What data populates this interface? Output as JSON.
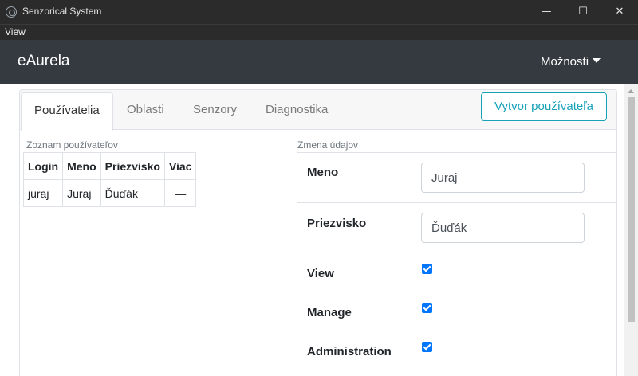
{
  "window": {
    "title": "Senzorical System",
    "controls": {
      "minimize": "—",
      "maximize": "☐",
      "close": "✕"
    }
  },
  "menu": {
    "view_label": "View"
  },
  "navbar": {
    "brand": "eAurela",
    "options_label": "Možnosti"
  },
  "tabs": [
    {
      "label": "Používatelia",
      "active": true
    },
    {
      "label": "Oblasti",
      "active": false
    },
    {
      "label": "Senzory",
      "active": false
    },
    {
      "label": "Diagnostika",
      "active": false
    }
  ],
  "create_user_label": "Vytvor používateľa",
  "users_section": {
    "label": "Zoznam používateľov",
    "columns": [
      "Login",
      "Meno",
      "Priezvisko",
      "Viac"
    ],
    "rows": [
      {
        "login": "juraj",
        "meno": "Juraj",
        "priezvisko": "Ďuďák",
        "viac": "—"
      }
    ]
  },
  "edit_section": {
    "label": "Zmena údajov",
    "meno_label": "Meno",
    "meno_value": "Juraj",
    "priezvisko_label": "Priezvisko",
    "priezvisko_value": "Ďuďák",
    "permissions": [
      {
        "label": "View",
        "checked": true
      },
      {
        "label": "Manage",
        "checked": true
      },
      {
        "label": "Administration",
        "checked": true
      }
    ]
  },
  "colors": {
    "accent": "#17a2b8",
    "navbar": "#343a40",
    "checkbox": "#0075ff"
  }
}
